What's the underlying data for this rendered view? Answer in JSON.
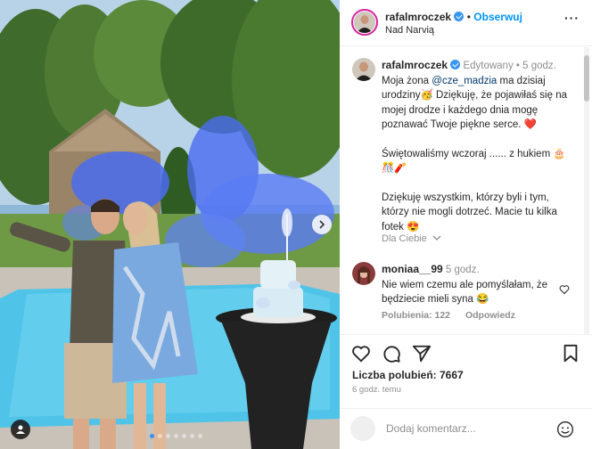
{
  "post": {
    "author": "rafalmroczek",
    "follow_label": "Obserwuj",
    "separator": "•",
    "location": "Nad Narvią",
    "more_label": "···"
  },
  "caption": {
    "author": "rafalmroczek",
    "edited_label": "Edytowany",
    "separator": "•",
    "time": "5 godz.",
    "text_part1": "Moja żona ",
    "mention": "@cze_madzia",
    "text_part2": " ma dzisiaj urodziny🥳 Dziękuję, że pojawiłaś się na mojej drodze i każdego dnia mogę poznawać Twoje piękne serce. ❤️",
    "paragraph2": "Świętowaliśmy wczoraj ...... z hukiem 🎂 🎊🧨",
    "paragraph3": "Dziękuję wszystkim, którzy byli i tym, którzy nie mogli dotrzeć. Macie tu kilka fotek 😍"
  },
  "translate_label": "Dla Ciebie",
  "comment": {
    "author": "moniaa__99",
    "time": "5 godz.",
    "text": "Nie wiem czemu ale pomyślałam, że będziecie mieli syna 😂",
    "likes_label": "Polubienia: 122",
    "reply_label": "Odpowiedz"
  },
  "stats": {
    "likes": "Liczba polubień: 7667",
    "time_ago": "6 godz. temu"
  },
  "add_comment": {
    "placeholder": "Dodaj komentarz..."
  },
  "carousel": {
    "total": 7,
    "active": 1
  },
  "colors": {
    "accent": "#0095f6",
    "verified": "#3897f0",
    "smoke": "#4a6cf0",
    "pool": "#4fc4e8"
  },
  "icons": [
    "heart-icon",
    "comment-icon",
    "share-icon",
    "bookmark-icon",
    "emoji-icon",
    "chevron-right-icon",
    "user-tag-icon",
    "chevron-down-icon"
  ]
}
